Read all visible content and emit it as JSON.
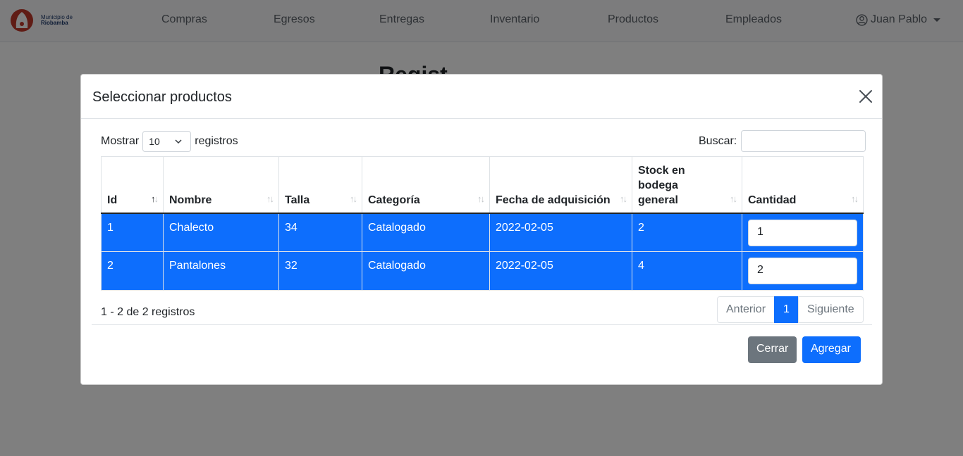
{
  "brand": {
    "line1": "Municipio de",
    "line2": "Riobamba",
    "accent_color": "#c0392b"
  },
  "nav": {
    "items": [
      "Compras",
      "Egresos",
      "Entregas",
      "Inventario",
      "Productos",
      "Empleados"
    ],
    "user": "Juan Pablo"
  },
  "page": {
    "heading_partial": "Regist"
  },
  "modal": {
    "title": "Seleccionar productos",
    "length": {
      "prefix": "Mostrar",
      "value": "10",
      "suffix": "registros"
    },
    "search": {
      "label": "Buscar:",
      "value": ""
    },
    "table": {
      "columns": [
        "Id",
        "Nombre",
        "Talla",
        "Categoría",
        "Fecha de adquisición",
        "Stock en bodega general",
        "Cantidad"
      ],
      "rows": [
        {
          "id": "1",
          "nombre": "Chalecto",
          "talla": "34",
          "categoria": "Catalogado",
          "fecha": "2022-02-05",
          "stock": "2",
          "cantidad": "1"
        },
        {
          "id": "2",
          "nombre": "Pantalones",
          "talla": "32",
          "categoria": "Catalogado",
          "fecha": "2022-02-05",
          "stock": "4",
          "cantidad": "2"
        }
      ],
      "selected_color": "#0d6efd"
    },
    "info": "1 - 2 de 2 registros",
    "pagination": {
      "prev": "Anterior",
      "current": "1",
      "next": "Siguiente"
    },
    "buttons": {
      "close": "Cerrar",
      "add": "Agregar"
    }
  }
}
